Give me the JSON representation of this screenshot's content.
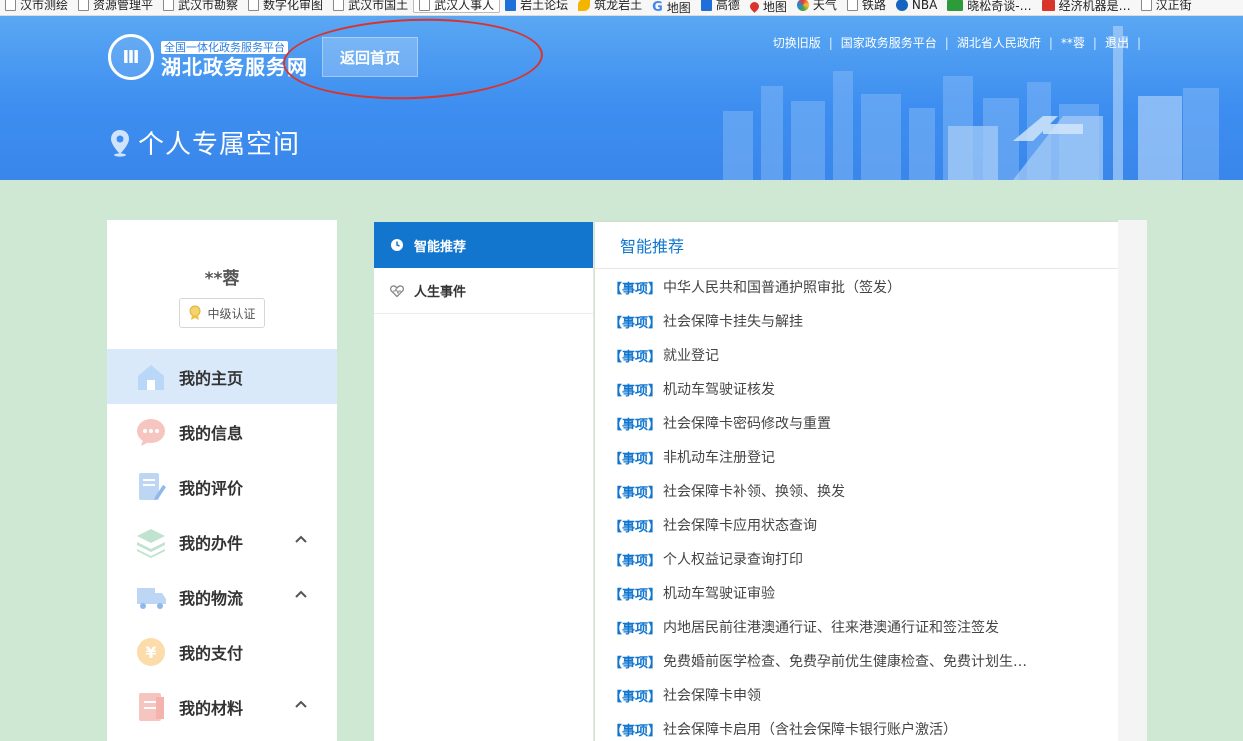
{
  "bookmarks": [
    {
      "label": "汉市测绘",
      "icon": "page-icon"
    },
    {
      "label": "资源管理平",
      "icon": "page-icon"
    },
    {
      "label": "武汉市勘察",
      "icon": "page-icon"
    },
    {
      "label": "数字化审图",
      "icon": "page-icon"
    },
    {
      "label": "武汉市国土",
      "icon": "page-icon"
    },
    {
      "label": "武汉人事人",
      "icon": "page-icon"
    },
    {
      "label": "岩土论坛",
      "icon": "forum-icon"
    },
    {
      "label": "筑龙岩土",
      "icon": "leaf-icon"
    },
    {
      "label": "地图",
      "icon": "google-icon"
    },
    {
      "label": "高德",
      "icon": "amap-icon"
    },
    {
      "label": "地图",
      "icon": "map-pin-icon"
    },
    {
      "label": "天气",
      "icon": "weather-icon"
    },
    {
      "label": "铁路",
      "icon": "page-icon"
    },
    {
      "label": "NBA",
      "icon": "nba-icon"
    },
    {
      "label": "晓松奇谈-…",
      "icon": "video-icon"
    },
    {
      "label": "经济机器是…",
      "icon": "video-red-icon"
    },
    {
      "label": "汉正街",
      "icon": "page-icon"
    }
  ],
  "header": {
    "logo_mark": "Ⅲ",
    "logo_sub": "全国一体化政务服务平台",
    "logo_main": "湖北政务服务网",
    "home_button": "返回首页",
    "top_links": [
      "切换旧版",
      "国家政务服务平台",
      "湖北省人民政府",
      "**蓉",
      "退出"
    ],
    "page_title": "个人专属空间"
  },
  "sidebar": {
    "username": "**蓉",
    "auth_level": "中级认证",
    "items": [
      {
        "label": "我的主页",
        "icon": "home-icon",
        "active": true,
        "expandable": false
      },
      {
        "label": "我的信息",
        "icon": "message-icon",
        "active": false,
        "expandable": false
      },
      {
        "label": "我的评价",
        "icon": "edit-icon",
        "active": false,
        "expandable": false
      },
      {
        "label": "我的办件",
        "icon": "layers-icon",
        "active": false,
        "expandable": true
      },
      {
        "label": "我的物流",
        "icon": "truck-icon",
        "active": false,
        "expandable": true
      },
      {
        "label": "我的支付",
        "icon": "yuan-icon",
        "active": false,
        "expandable": false
      },
      {
        "label": "我的材料",
        "icon": "document-icon",
        "active": false,
        "expandable": true
      }
    ]
  },
  "tabs": [
    {
      "label": "智能推荐",
      "icon": "clock-icon",
      "active": true
    },
    {
      "label": "人生事件",
      "icon": "heart-icon",
      "active": false
    }
  ],
  "list": {
    "title": "智能推荐",
    "tag": "【事项】",
    "items": [
      "中华人民共和国普通护照审批（签发）",
      "社会保障卡挂失与解挂",
      "就业登记",
      "机动车驾驶证核发",
      "社会保障卡密码修改与重置",
      "非机动车注册登记",
      "社会保障卡补领、换领、换发",
      "社会保障卡应用状态查询",
      "个人权益记录查询打印",
      "机动车驾驶证审验",
      "内地居民前往港澳通行证、往来港澳通行证和签注签发",
      "免费婚前医学检查、免费孕前优生健康检查、免费计划生…",
      "社会保障卡申领",
      "社会保障卡启用（含社会保障卡银行账户激活）"
    ]
  },
  "colors": {
    "header_blue": "#3d8ef0",
    "accent_blue": "#1276cf",
    "active_nav_bg": "#dae9f9",
    "page_bg": "#cfe8d3",
    "annotation_red": "#d8342f"
  }
}
